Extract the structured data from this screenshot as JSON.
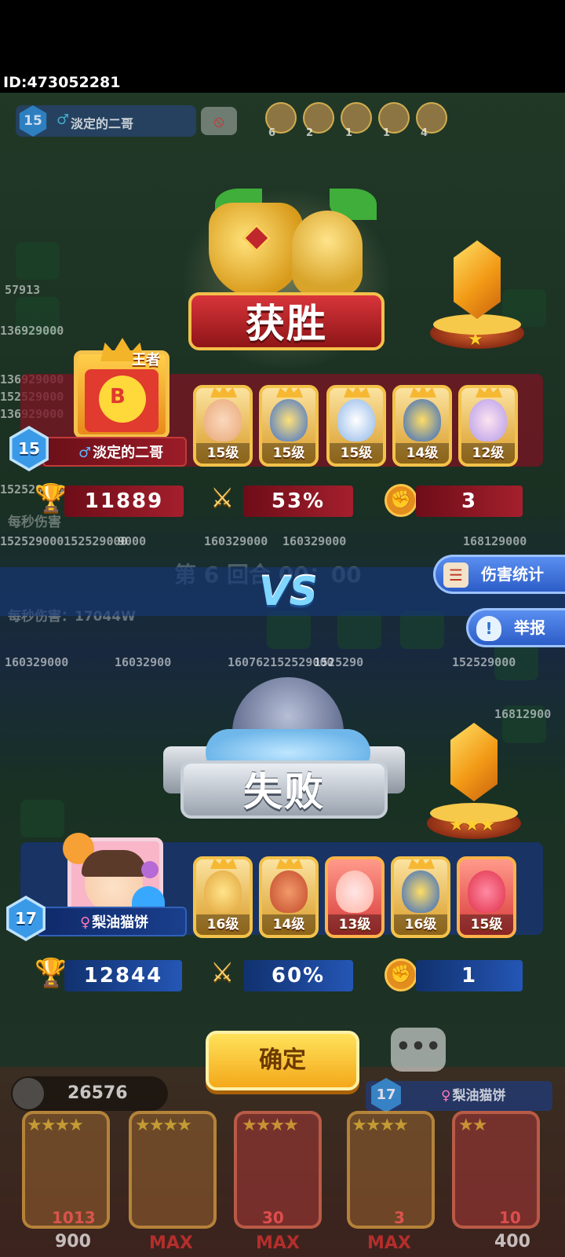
{
  "player_id": "ID:473052281",
  "opponent_strip": {
    "level": "15",
    "name": "淡定的二哥",
    "mini_hero_counts": [
      "6",
      "2",
      "1",
      "1",
      "4"
    ]
  },
  "floating_numbers": [
    "57913",
    "136929000",
    "136929000",
    "152529000",
    "136929000",
    "152529000",
    "152529000152529000",
    "0000",
    "9000",
    "160329000",
    "160329000",
    "168129000",
    "160329000",
    "16032900",
    "160762152529000",
    "1525290",
    "152529000",
    "16812900"
  ],
  "damage_per_second": {
    "top": "每秒伤害",
    "bottom": "每秒伤害：17044W"
  },
  "round_text": "第 6 回合 00：00",
  "winner": {
    "result_label": "获胜",
    "crown_label": "王者",
    "level": "15",
    "gender": "♂",
    "name": "淡定的二哥",
    "rank_stars": "★",
    "heroes": [
      {
        "level": "15级"
      },
      {
        "level": "15级"
      },
      {
        "level": "15级"
      },
      {
        "level": "14级"
      },
      {
        "level": "12级"
      }
    ],
    "trophies": "11889",
    "win_rate": "53%",
    "fists": "3"
  },
  "vs_label": "VS",
  "side_buttons": {
    "damage_stats": "伤害统计",
    "report": "举报"
  },
  "loser": {
    "result_label": "失败",
    "level": "17",
    "gender": "♀",
    "name": "梨油猫饼",
    "rank_stars": "★★★",
    "heroes": [
      {
        "level": "16级"
      },
      {
        "level": "14级"
      },
      {
        "level": "13级"
      },
      {
        "level": "16级"
      },
      {
        "level": "15级"
      }
    ],
    "trophies": "12844",
    "win_rate": "60%",
    "fists": "1"
  },
  "confirm_label": "确定",
  "chat_label": "•••",
  "bottom_bar": {
    "coins": "26576",
    "opponent_level": "17",
    "opponent_gender": "♀",
    "opponent_name": "梨油猫饼",
    "cards": [
      {
        "stars": "★★★★",
        "count": "1013",
        "cost": "900"
      },
      {
        "stars": "★★★★",
        "count": "",
        "cost": "MAX"
      },
      {
        "stars": "★★★★",
        "count": "30",
        "cost": "MAX"
      },
      {
        "stars": "★★★★",
        "count": "3",
        "cost": "MAX"
      },
      {
        "stars": "★★",
        "count": "10",
        "cost": "400"
      }
    ]
  },
  "colors": {
    "win_red": "#a51f2d",
    "lose_blue": "#2456b5",
    "gold": "#f3c24a",
    "vs_blue": "#7fd6ff"
  },
  "icons": [
    "cup-icon",
    "sword-icon",
    "fist-icon",
    "ban-icon",
    "report-shield-icon",
    "damage-list-icon",
    "chat-icon",
    "coin-icon"
  ]
}
